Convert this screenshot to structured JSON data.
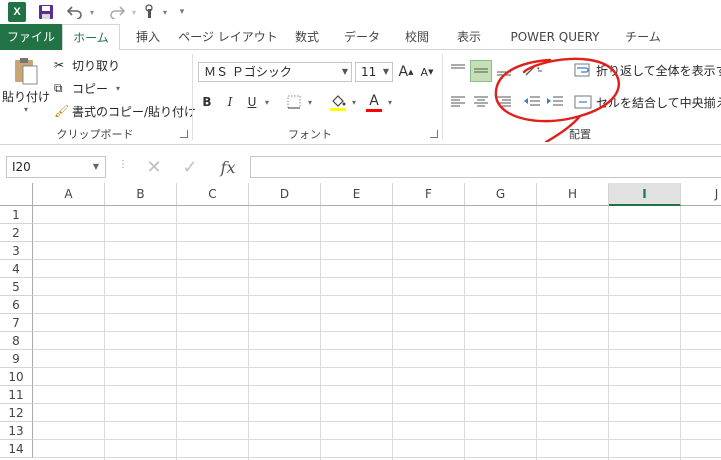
{
  "qat": {
    "app_icon": "excel-logo",
    "app_letter": "X",
    "icons": [
      "save-icon",
      "undo-icon",
      "redo-icon",
      "touch-mode-icon",
      "customize-icon"
    ]
  },
  "tabs": [
    {
      "label": "ファイル",
      "name": "tab-file"
    },
    {
      "label": "ホーム",
      "name": "tab-home"
    },
    {
      "label": "挿入",
      "name": "tab-insert"
    },
    {
      "label": "ページ レイアウト",
      "name": "tab-page-layout"
    },
    {
      "label": "数式",
      "name": "tab-formulas"
    },
    {
      "label": "データ",
      "name": "tab-data"
    },
    {
      "label": "校閲",
      "name": "tab-review"
    },
    {
      "label": "表示",
      "name": "tab-view"
    },
    {
      "label": "POWER QUERY",
      "name": "tab-power-query"
    },
    {
      "label": "チーム",
      "name": "tab-team"
    }
  ],
  "clipboard": {
    "paste_label": "貼り付け",
    "cut_label": "切り取り",
    "copy_label": "コピー",
    "format_painter_label": "書式のコピー/貼り付け",
    "group_label": "クリップボード"
  },
  "font": {
    "font_name": "ＭＳ Ｐゴシック",
    "font_size": "11",
    "grow_label": "A",
    "shrink_label": "A",
    "bold": "B",
    "italic": "I",
    "underline": "U",
    "font_color_letter": "A",
    "group_label": "フォント",
    "fill_color": "#ffff00",
    "font_color": "#ff0000"
  },
  "alignment": {
    "wrap_text_label": "折り返して全体を表示する",
    "merge_center_label": "セルを結合して中央揃え",
    "group_label": "配置"
  },
  "formula_bar": {
    "name_box": "I20",
    "fx_label": "fx",
    "formula": ""
  },
  "grid": {
    "columns": [
      "A",
      "B",
      "C",
      "D",
      "E",
      "F",
      "G",
      "H",
      "I",
      "J"
    ],
    "selected_column": "I",
    "rows": [
      "1",
      "2",
      "3",
      "4",
      "5",
      "6",
      "7",
      "8",
      "9",
      "10",
      "11",
      "12",
      "13",
      "14"
    ]
  },
  "colors": {
    "accent": "#217346",
    "annotation": "#e0201a"
  }
}
